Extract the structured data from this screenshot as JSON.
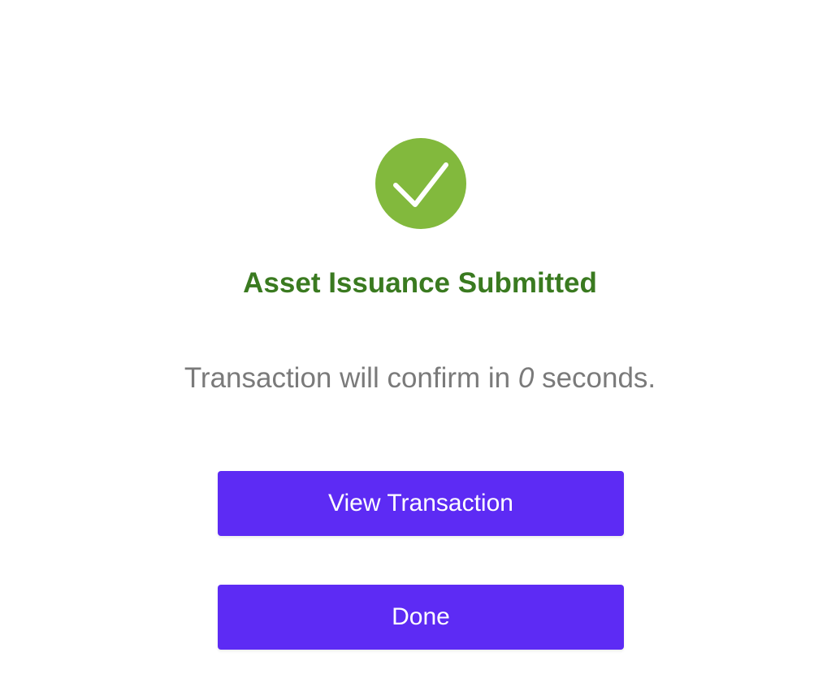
{
  "status": {
    "icon": "checkmark-circle-icon",
    "icon_color": "#82b93d",
    "title": "Asset Issuance Submitted",
    "title_color": "#3a7a20"
  },
  "confirmation": {
    "prefix": "Transaction will confirm in ",
    "seconds": "0",
    "suffix": " seconds."
  },
  "actions": {
    "view_transaction_label": "View Transaction",
    "done_label": "Done",
    "button_color": "#5d2bf4"
  }
}
